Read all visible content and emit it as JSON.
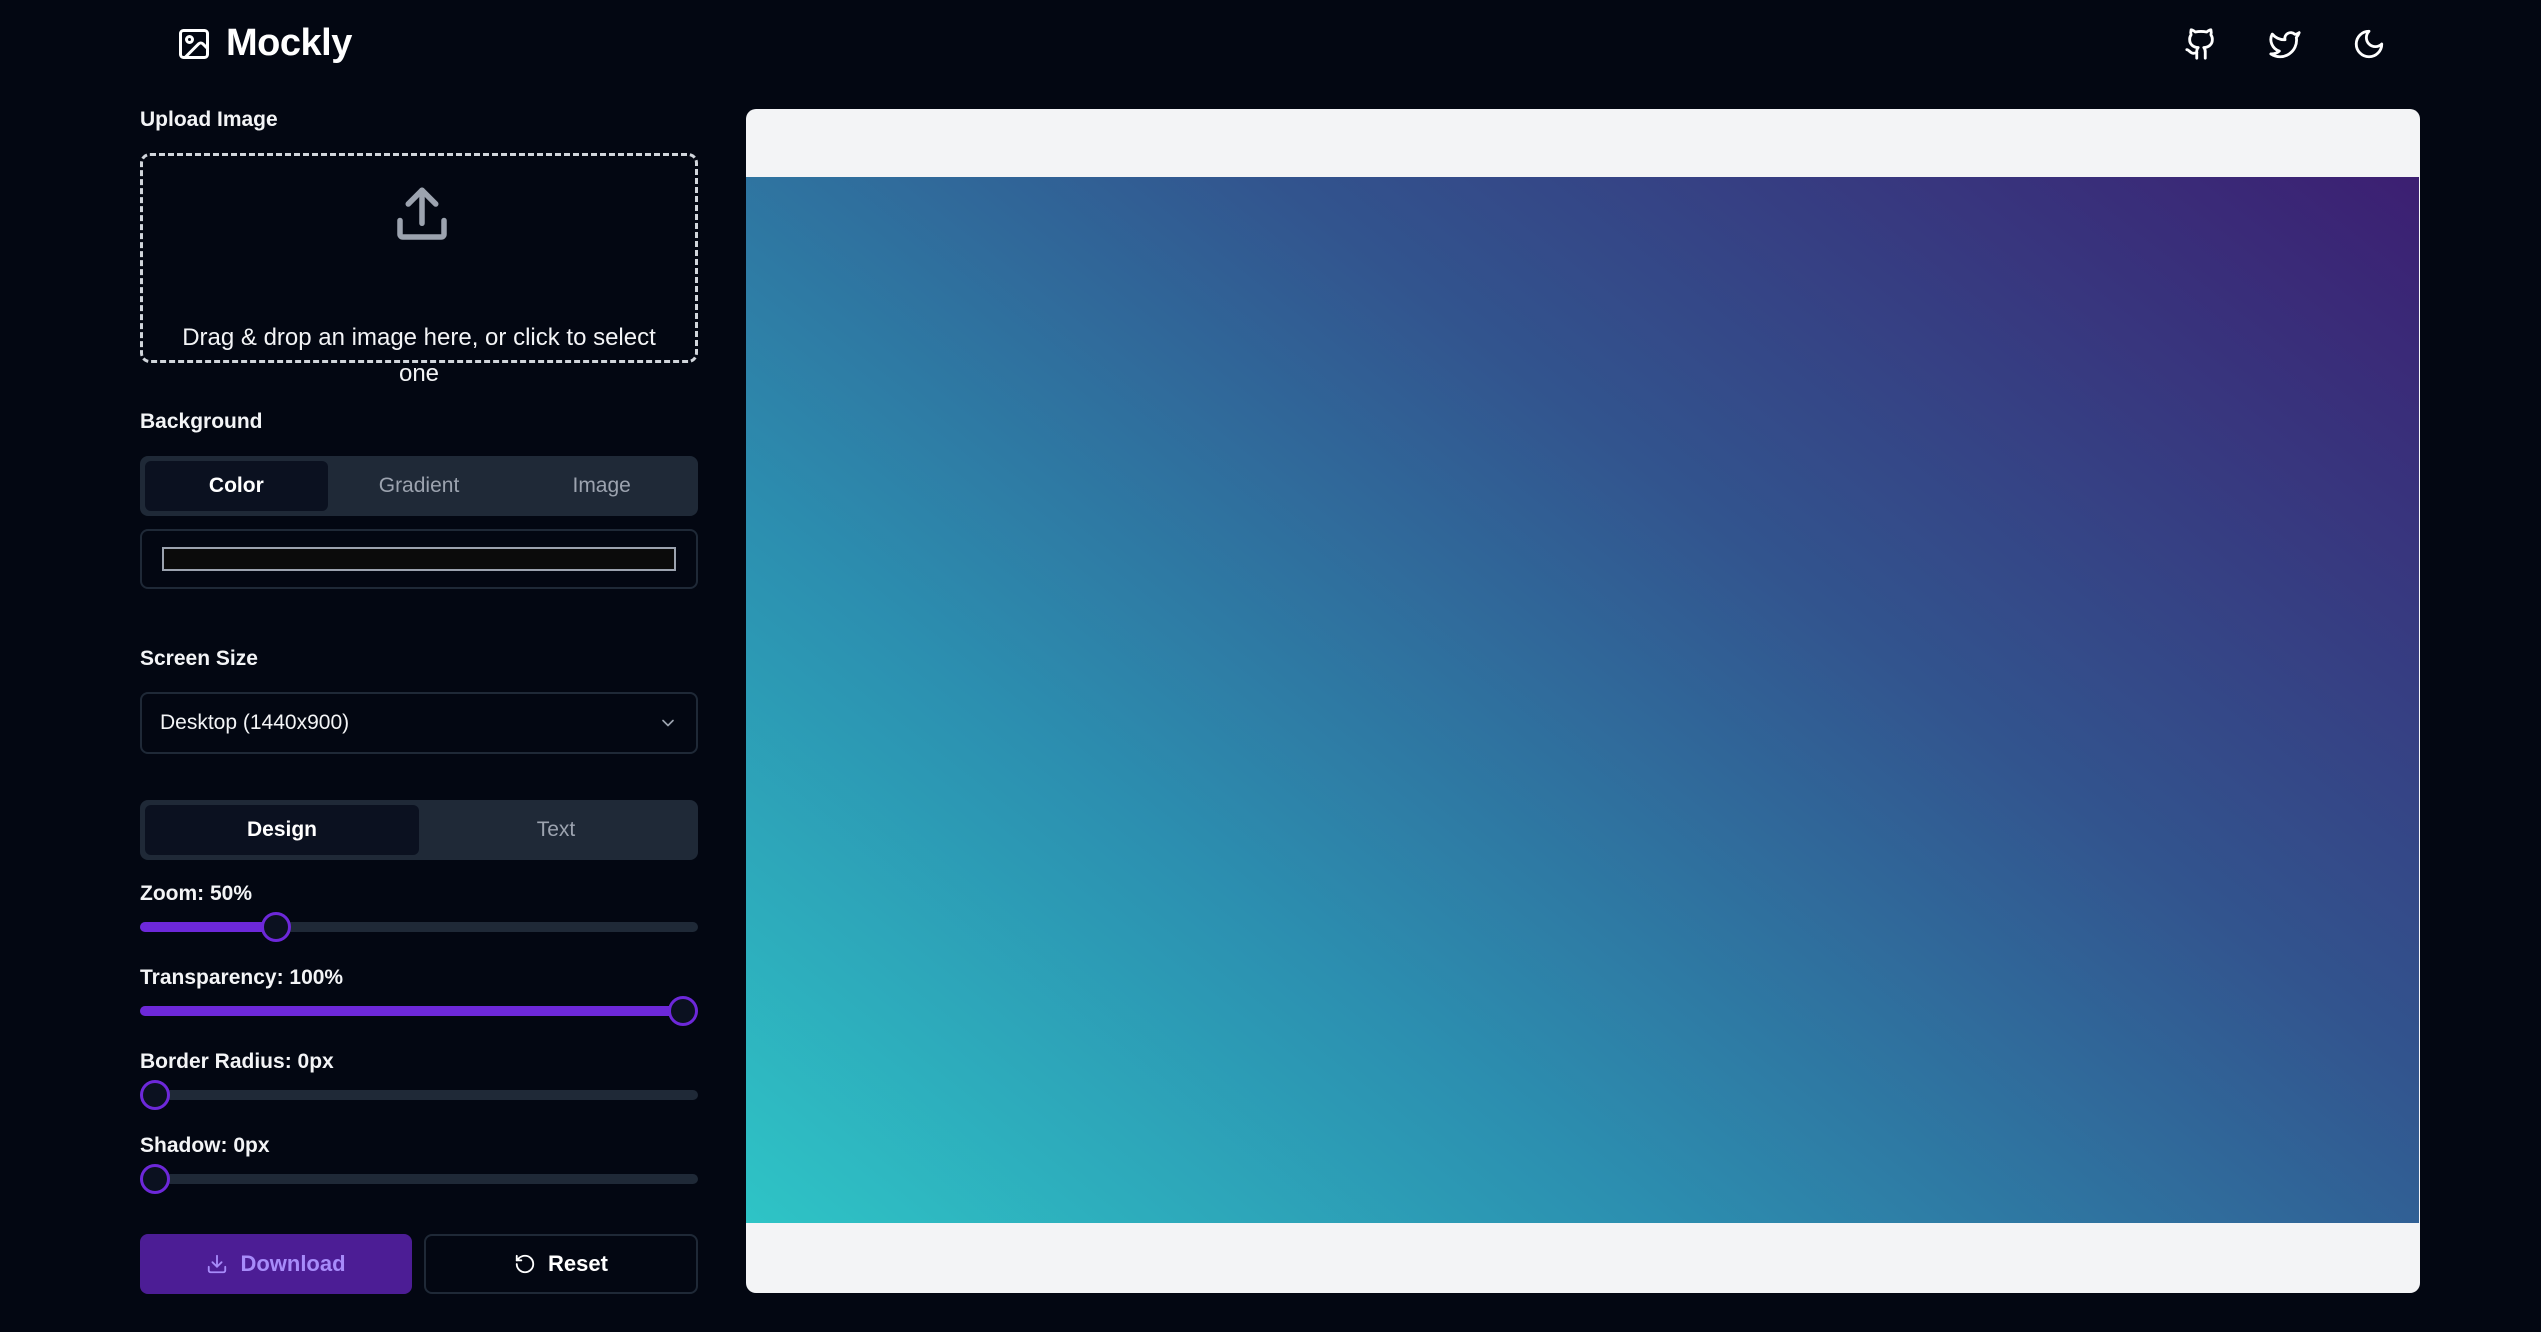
{
  "header": {
    "app_name": "Mockly",
    "logo_icon": "image-icon",
    "actions": [
      {
        "name": "github-icon"
      },
      {
        "name": "twitter-icon"
      },
      {
        "name": "moon-icon"
      }
    ]
  },
  "upload": {
    "label": "Upload Image",
    "icon": "upload-icon",
    "prompt": "Drag & drop an image here, or click to select one"
  },
  "background": {
    "label": "Background",
    "tabs": [
      "Color",
      "Gradient",
      "Image"
    ],
    "active_tab": "Color",
    "color_value": "#0b0b0b"
  },
  "screen_size": {
    "label": "Screen Size",
    "selected": "Desktop (1440x900)"
  },
  "settings_tabs": {
    "tabs": [
      "Design",
      "Text"
    ],
    "active_tab": "Design"
  },
  "sliders": {
    "zoom": {
      "label": "Zoom: 50%",
      "value_fraction": 0.23
    },
    "transparency": {
      "label": "Transparency: 100%",
      "value_fraction": 1.0
    },
    "border_radius": {
      "label": "Border Radius: 0px",
      "value_fraction": 0.0
    },
    "shadow": {
      "label": "Shadow: 0px",
      "value_fraction": 0.0
    }
  },
  "buttons": {
    "download": "Download",
    "reset": "Reset"
  },
  "preview": {
    "gradient_colors": [
      "#2ec4c6",
      "#2c8fb0",
      "#32548e",
      "#3c1f72"
    ],
    "frame_color": "#f3f4f6"
  },
  "colors": {
    "accent": "#6d28d9",
    "background": "#030712",
    "panel": "#1f2937"
  }
}
